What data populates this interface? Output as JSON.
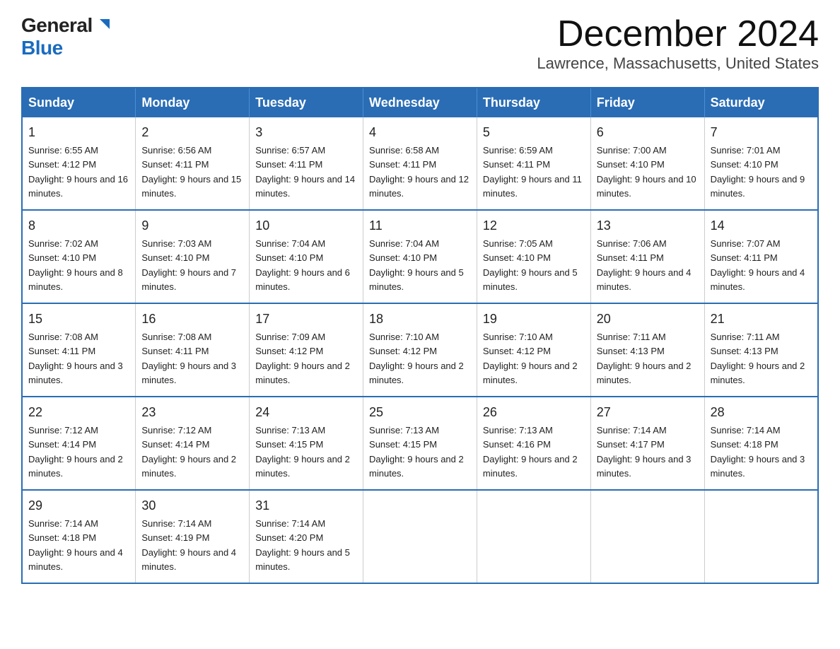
{
  "logo": {
    "line1": "General",
    "line2": "Blue"
  },
  "title": "December 2024",
  "subtitle": "Lawrence, Massachusetts, United States",
  "weekdays": [
    "Sunday",
    "Monday",
    "Tuesday",
    "Wednesday",
    "Thursday",
    "Friday",
    "Saturday"
  ],
  "weeks": [
    [
      {
        "day": "1",
        "sunrise": "6:55 AM",
        "sunset": "4:12 PM",
        "daylight": "9 hours and 16 minutes."
      },
      {
        "day": "2",
        "sunrise": "6:56 AM",
        "sunset": "4:11 PM",
        "daylight": "9 hours and 15 minutes."
      },
      {
        "day": "3",
        "sunrise": "6:57 AM",
        "sunset": "4:11 PM",
        "daylight": "9 hours and 14 minutes."
      },
      {
        "day": "4",
        "sunrise": "6:58 AM",
        "sunset": "4:11 PM",
        "daylight": "9 hours and 12 minutes."
      },
      {
        "day": "5",
        "sunrise": "6:59 AM",
        "sunset": "4:11 PM",
        "daylight": "9 hours and 11 minutes."
      },
      {
        "day": "6",
        "sunrise": "7:00 AM",
        "sunset": "4:10 PM",
        "daylight": "9 hours and 10 minutes."
      },
      {
        "day": "7",
        "sunrise": "7:01 AM",
        "sunset": "4:10 PM",
        "daylight": "9 hours and 9 minutes."
      }
    ],
    [
      {
        "day": "8",
        "sunrise": "7:02 AM",
        "sunset": "4:10 PM",
        "daylight": "9 hours and 8 minutes."
      },
      {
        "day": "9",
        "sunrise": "7:03 AM",
        "sunset": "4:10 PM",
        "daylight": "9 hours and 7 minutes."
      },
      {
        "day": "10",
        "sunrise": "7:04 AM",
        "sunset": "4:10 PM",
        "daylight": "9 hours and 6 minutes."
      },
      {
        "day": "11",
        "sunrise": "7:04 AM",
        "sunset": "4:10 PM",
        "daylight": "9 hours and 5 minutes."
      },
      {
        "day": "12",
        "sunrise": "7:05 AM",
        "sunset": "4:10 PM",
        "daylight": "9 hours and 5 minutes."
      },
      {
        "day": "13",
        "sunrise": "7:06 AM",
        "sunset": "4:11 PM",
        "daylight": "9 hours and 4 minutes."
      },
      {
        "day": "14",
        "sunrise": "7:07 AM",
        "sunset": "4:11 PM",
        "daylight": "9 hours and 4 minutes."
      }
    ],
    [
      {
        "day": "15",
        "sunrise": "7:08 AM",
        "sunset": "4:11 PM",
        "daylight": "9 hours and 3 minutes."
      },
      {
        "day": "16",
        "sunrise": "7:08 AM",
        "sunset": "4:11 PM",
        "daylight": "9 hours and 3 minutes."
      },
      {
        "day": "17",
        "sunrise": "7:09 AM",
        "sunset": "4:12 PM",
        "daylight": "9 hours and 2 minutes."
      },
      {
        "day": "18",
        "sunrise": "7:10 AM",
        "sunset": "4:12 PM",
        "daylight": "9 hours and 2 minutes."
      },
      {
        "day": "19",
        "sunrise": "7:10 AM",
        "sunset": "4:12 PM",
        "daylight": "9 hours and 2 minutes."
      },
      {
        "day": "20",
        "sunrise": "7:11 AM",
        "sunset": "4:13 PM",
        "daylight": "9 hours and 2 minutes."
      },
      {
        "day": "21",
        "sunrise": "7:11 AM",
        "sunset": "4:13 PM",
        "daylight": "9 hours and 2 minutes."
      }
    ],
    [
      {
        "day": "22",
        "sunrise": "7:12 AM",
        "sunset": "4:14 PM",
        "daylight": "9 hours and 2 minutes."
      },
      {
        "day": "23",
        "sunrise": "7:12 AM",
        "sunset": "4:14 PM",
        "daylight": "9 hours and 2 minutes."
      },
      {
        "day": "24",
        "sunrise": "7:13 AM",
        "sunset": "4:15 PM",
        "daylight": "9 hours and 2 minutes."
      },
      {
        "day": "25",
        "sunrise": "7:13 AM",
        "sunset": "4:15 PM",
        "daylight": "9 hours and 2 minutes."
      },
      {
        "day": "26",
        "sunrise": "7:13 AM",
        "sunset": "4:16 PM",
        "daylight": "9 hours and 2 minutes."
      },
      {
        "day": "27",
        "sunrise": "7:14 AM",
        "sunset": "4:17 PM",
        "daylight": "9 hours and 3 minutes."
      },
      {
        "day": "28",
        "sunrise": "7:14 AM",
        "sunset": "4:18 PM",
        "daylight": "9 hours and 3 minutes."
      }
    ],
    [
      {
        "day": "29",
        "sunrise": "7:14 AM",
        "sunset": "4:18 PM",
        "daylight": "9 hours and 4 minutes."
      },
      {
        "day": "30",
        "sunrise": "7:14 AM",
        "sunset": "4:19 PM",
        "daylight": "9 hours and 4 minutes."
      },
      {
        "day": "31",
        "sunrise": "7:14 AM",
        "sunset": "4:20 PM",
        "daylight": "9 hours and 5 minutes."
      },
      null,
      null,
      null,
      null
    ]
  ]
}
